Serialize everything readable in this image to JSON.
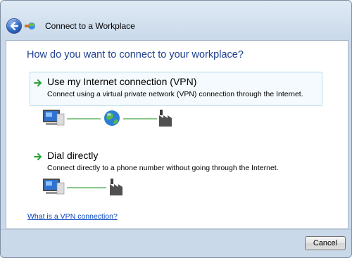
{
  "window": {
    "title": "Connect to a Workplace"
  },
  "main": {
    "heading": "How do you want to connect to your workplace?",
    "options": [
      {
        "title": "Use my Internet connection (VPN)",
        "description": "Connect using a virtual private network (VPN) connection through the Internet."
      },
      {
        "title": "Dial directly",
        "description": "Connect directly to a phone number without going through the Internet."
      }
    ],
    "help_link": "What is a VPN connection?"
  },
  "footer": {
    "cancel_label": "Cancel"
  },
  "colors": {
    "heading": "#1e3f8f",
    "link": "#0b46c0",
    "selection_border": "#b5dbee",
    "connector_line": "#8bc98b",
    "arrow": "#2aa23a"
  },
  "icons": {
    "back": "back-arrow-icon",
    "wizard": "network-wizard-icon",
    "option_arrow": "green-arrow-icon",
    "computer": "computer-icon",
    "globe": "globe-icon",
    "factory": "factory-icon"
  }
}
